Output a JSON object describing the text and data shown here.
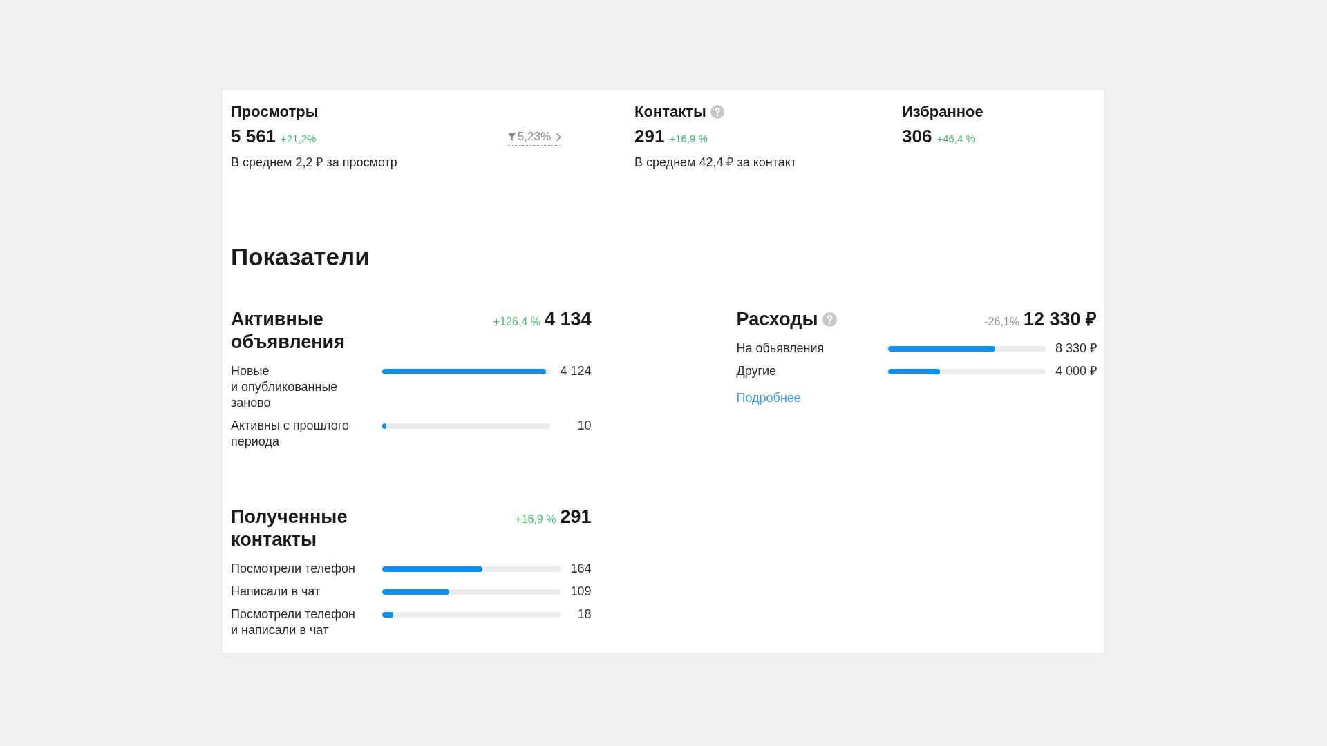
{
  "metrics": [
    {
      "title": "Просмотры",
      "help": false,
      "value": "5 561",
      "change": "+21,2%",
      "increase": true,
      "conversion": "5,23%",
      "subtitle": "В среднем 2,2 ₽ за просмотр"
    },
    {
      "title": "Контакты",
      "help": true,
      "value": "291",
      "change": "+16,9 %",
      "increase": true,
      "subtitle": "В среднем 42,4 ₽ за контакт"
    },
    {
      "title": "Избранное",
      "help": false,
      "value": "306",
      "change": "+46,4 %",
      "increase": true
    }
  ],
  "indicators": {
    "title": "Показатели",
    "columns": [
      {
        "panels": [
          {
            "title": "Активные объявления",
            "help": false,
            "change": "+126,4 %",
            "increase": true,
            "total": "4 134",
            "rows": [
              {
                "label": "Новые и опубликованные заново",
                "level": 0.975,
                "value": "4 124"
              },
              {
                "label": "Активны с прошлого периода",
                "level": 0.025,
                "value": "10"
              }
            ]
          },
          {
            "title": "Полученные контакты",
            "help": false,
            "change": "+16,9 %",
            "increase": true,
            "total": "291",
            "rows": [
              {
                "label": "Посмотрели телефон",
                "level": 0.56,
                "value": "164"
              },
              {
                "label": "Написали в чат",
                "level": 0.375,
                "value": "109"
              },
              {
                "label": "Посмотрели телефон и написали в чат",
                "level": 0.06,
                "value": "18"
              }
            ]
          }
        ]
      },
      {
        "panels": [
          {
            "title": "Расходы",
            "help": true,
            "change": "-26,1%",
            "increase": false,
            "total": "12 330 ₽",
            "rows": [
              {
                "label": "На обьявления",
                "level": 0.68,
                "value": "8 330 ₽"
              },
              {
                "label": "Другие",
                "level": 0.33,
                "value": "4 000 ₽"
              }
            ],
            "link": "Подробнее"
          }
        ]
      }
    ]
  }
}
